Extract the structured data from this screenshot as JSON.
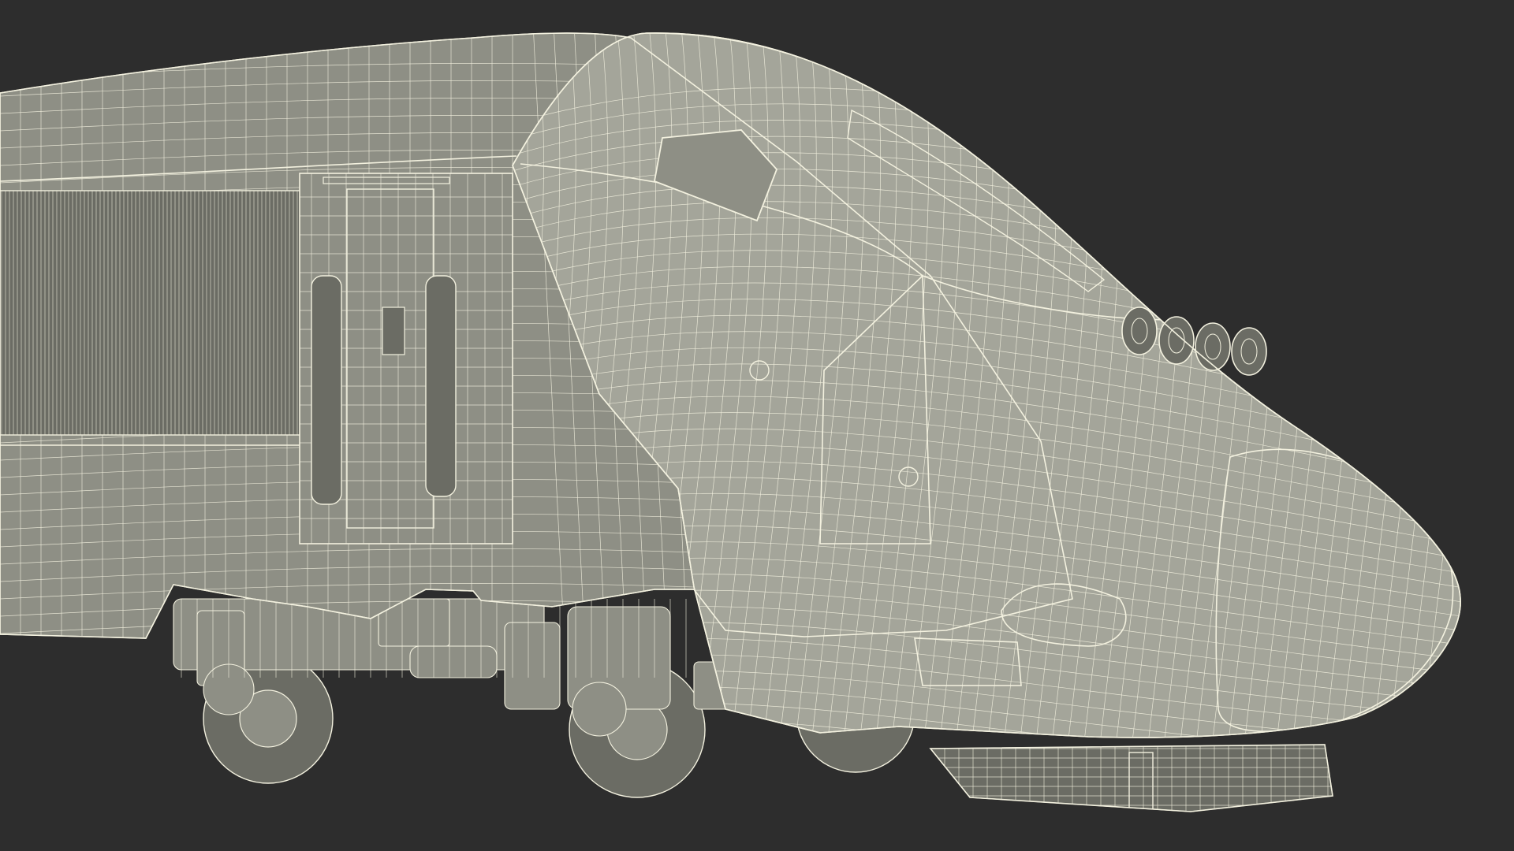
{
  "scene": {
    "subject": "wireframe-high-speed-train-nose",
    "background_color": "#2d2d2d",
    "surface_color": "#8e8f85",
    "surface_shadow_color": "#6b6c64",
    "surface_light_color": "#a4a59a",
    "wire_color": "#f3f1df",
    "dark_wire_color": "#2b2b27"
  }
}
